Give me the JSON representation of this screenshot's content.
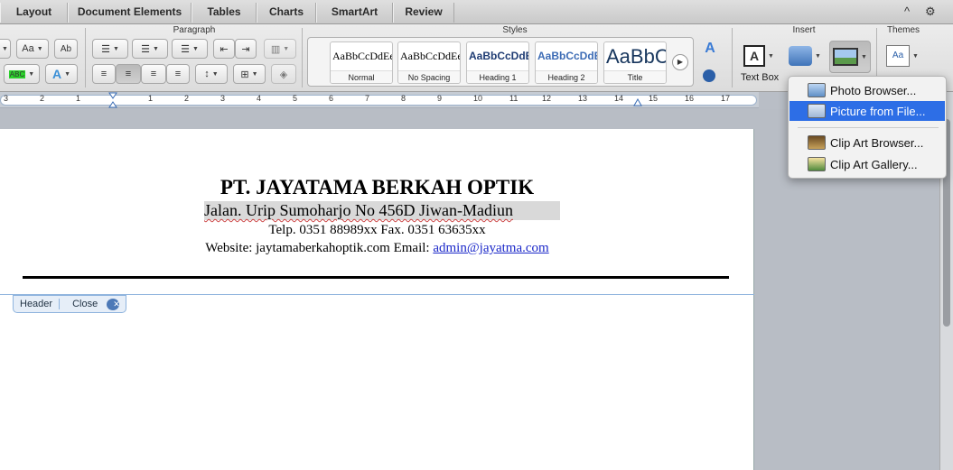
{
  "tabs": [
    "Layout",
    "Document Elements",
    "Tables",
    "Charts",
    "SmartArt",
    "Review"
  ],
  "tab_controls": {
    "collapse": "^",
    "settings": "⚙"
  },
  "ribbon": {
    "groups": {
      "paragraph": "Paragraph",
      "styles": "Styles",
      "insert": "Insert",
      "themes": "Themes"
    },
    "styles": [
      {
        "sample": "AaBbCcDdEe",
        "name": "Normal"
      },
      {
        "sample": "AaBbCcDdEe",
        "name": "No Spacing"
      },
      {
        "sample": "AaBbCcDdEe",
        "name": "Heading 1"
      },
      {
        "sample": "AaBbCcDdEe",
        "name": "Heading 2"
      },
      {
        "sample": "AaBbC",
        "name": "Title"
      }
    ],
    "text_box_label": "Text Box",
    "font_aa": "Aa",
    "spell_ab": "Ab",
    "abc": "ABC"
  },
  "ruler": {
    "numbers": [
      "3",
      "2",
      "1",
      "1",
      "2",
      "3",
      "4",
      "5",
      "6",
      "7",
      "8",
      "9",
      "10",
      "11",
      "12",
      "13",
      "14",
      "15",
      "16",
      "17"
    ]
  },
  "document": {
    "company": "PT. JAYATAMA BERKAH OPTIK",
    "address": "Jalan. Urip Sumoharjo No 456D Jiwan-Madiun",
    "phone": "Telp. 0351 88989xx Fax. 0351 63635xx",
    "website_prefix": "Website: jaytamaberkahoptik.com Email: ",
    "email": "admin@jayatma.com"
  },
  "header_tab": {
    "label": "Header",
    "close": "Close"
  },
  "picture_menu": {
    "items": [
      "Photo Browser...",
      "Picture from File...",
      "Clip Art Browser...",
      "Clip Art Gallery..."
    ],
    "active_index": 1
  }
}
